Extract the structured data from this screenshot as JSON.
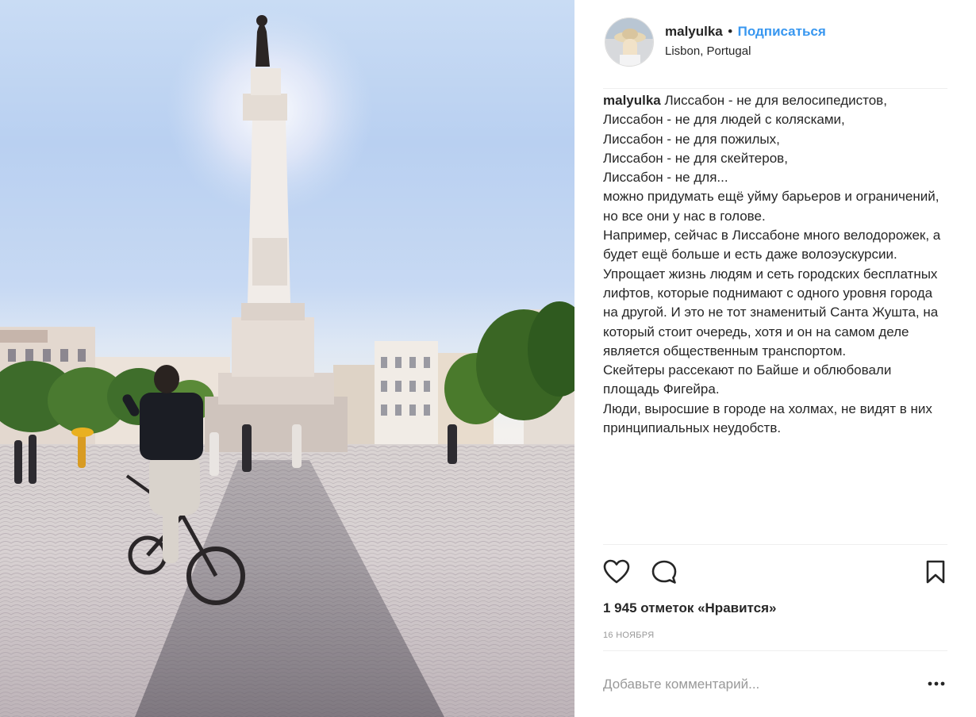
{
  "post": {
    "username": "malyulka",
    "separator": "•",
    "follow_label": "Подписаться",
    "location": "Lisbon, Portugal"
  },
  "caption": {
    "username": "malyulka",
    "text": " Лиссабон - не для велосипедистов,\nЛиссабон - не для людей с колясками,\nЛиссабон - не для пожилых,\nЛиссабон - не для скейтеров,\nЛиссабон - не для...\nможно придумать ещё уйму барьеров и ограничений, но все они у нас в голове.\nНапример, сейчас в Лиссабоне много велодорожек, а будет ещё больше и есть даже волоэускурсии. Упрощает жизнь людям и сеть городских бесплатных лифтов, которые поднимают с одного уровня города на другой. И это не тот знаменитый Санта Жушта, на который стоит очередь, хотя и он на самом деле является общественным транспортом.\nСкейтеры рассекают по Байше и облюбовали площадь Фигейра.\nЛюди, выросшие в городе на холмах, не видят в них принципиальных неудобств."
  },
  "actions": {
    "like_icon": "heart-outline-icon",
    "comment_icon": "comment-bubble-icon",
    "save_icon": "bookmark-outline-icon"
  },
  "likes_text": "1 945 отметок «Нравится»",
  "date": "16 НОЯБРЯ",
  "comment": {
    "placeholder": "Добавьте комментарий...",
    "more_icon": "ellipsis-icon"
  },
  "colors": {
    "link_blue": "#3897f0",
    "text": "#262626",
    "muted": "#999999",
    "divider": "#efefef"
  }
}
